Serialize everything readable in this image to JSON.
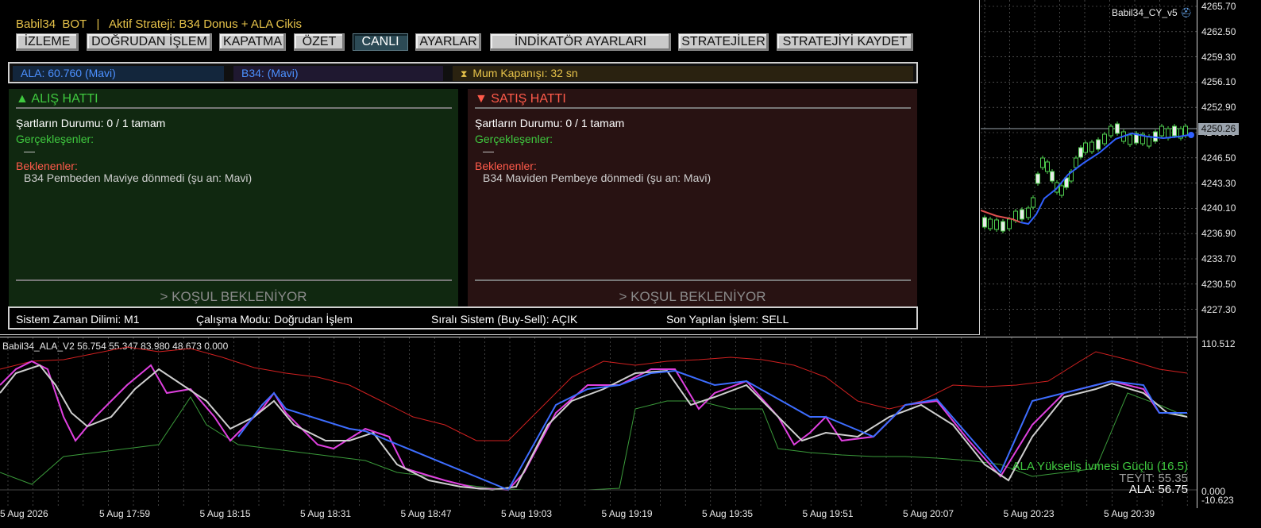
{
  "panel": {
    "title": "Babil34  BOT   |   Aktif Strateji: B34 Donus + ALA Cikis",
    "buttons": [
      "İZLEME",
      "DOĞRUDAN İŞLEM",
      "KAPATMA",
      "ÖZET",
      "CANLI",
      "AYARLAR",
      "İNDİKATÖR AYARLARI",
      "STRATEJİLER",
      "STRATEJİYİ KAYDET"
    ],
    "active_button": "CANLI",
    "info": {
      "ala": "ALA: 60.760 (Mavi)",
      "b34": "B34: (Mavi)",
      "candle": "Mum Kapanışı: 32 sn",
      "candle_icon": "hourglass-icon"
    },
    "buy": {
      "header": "▲ ALIŞ HATTI",
      "status": "Şartların Durumu: 0 / 1 tamam",
      "met_label": "Gerçekleşenler:",
      "met_value": "—",
      "pending_label": "Beklenenler:",
      "pending_item": "B34 Pembeden Maviye dönmedi (şu an: Mavi)",
      "waiting": "> KOŞUL BEKLENİYOR"
    },
    "sell": {
      "header": "▼ SATIŞ HATTI",
      "status": "Şartların Durumu: 0 / 1 tamam",
      "met_label": "Gerçekleşenler:",
      "met_value": "—",
      "pending_label": "Beklenenler:",
      "pending_item": "B34 Maviden Pembeye dönmedi (şu an: Mavi)",
      "waiting": "> KOŞUL BEKLENİYOR"
    },
    "status": {
      "timeframe": "Sistem Zaman Dilimi: M1",
      "mode": "Çalışma Modu: Doğrudan İşlem",
      "sequential": "Sıralı Sistem (Buy-Sell): AÇIK",
      "last_trade": "Son Yapılan İşlem: SELL"
    }
  },
  "price_chart": {
    "symbol": "Babil34_CY_v5",
    "price_scale": [
      "4265.70",
      "4262.50",
      "4259.30",
      "4256.10",
      "4252.90",
      "4249.70",
      "4246.50",
      "4243.30",
      "4240.10",
      "4236.90",
      "4233.70",
      "4230.50",
      "4227.30"
    ],
    "current_price": "4250.26"
  },
  "indicator": {
    "title": "Babil34_ALA_V2 56.754 55.347 83.980 48.673 0.000",
    "scale_top": "110.512",
    "scale_zero": "0.000",
    "scale_bottom": "-10.623",
    "msg1": "ALA Yükseliş İvmesi Güçlü (16.5)",
    "msg2": "TEYİT: 55.35",
    "msg3": "ALA: 56.75"
  },
  "time_axis": [
    "5 Aug 2026",
    "5 Aug 17:59",
    "5 Aug 18:15",
    "5 Aug 18:31",
    "5 Aug 18:47",
    "5 Aug 19:03",
    "5 Aug 19:19",
    "5 Aug 19:35",
    "5 Aug 19:51",
    "5 Aug 20:07",
    "5 Aug 20:23",
    "5 Aug 20:39"
  ],
  "colors": {
    "title": "#e7c34a",
    "buy_bg": "#102810",
    "sell_bg": "#281212",
    "buy_text": "#3fc93f",
    "sell_text": "#ff5a4a",
    "ala_blue": "#2f6fff",
    "pink": "#e040e0"
  }
}
